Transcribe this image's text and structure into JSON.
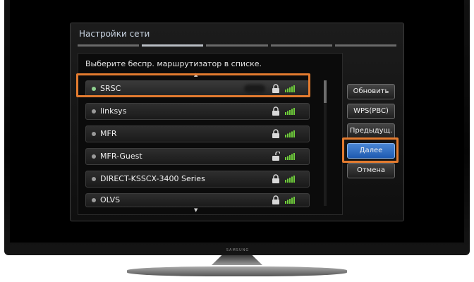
{
  "tv": {
    "brand": "SAMSUNG"
  },
  "dialog": {
    "title": "Настройки сети",
    "progress_step": 2,
    "progress_total": 5
  },
  "list": {
    "heading": "Выберите беспр. маршрутизатор в списке.",
    "selected_ssid": "SRSC",
    "networks": [
      {
        "ssid": "SRSC",
        "secured": true,
        "signal_bars": 4
      },
      {
        "ssid": "linksys",
        "secured": true,
        "signal_bars": 4
      },
      {
        "ssid": "MFR",
        "secured": true,
        "signal_bars": 4
      },
      {
        "ssid": "MFR-Guest",
        "secured": false,
        "signal_bars": 4
      },
      {
        "ssid": "DIRECT-KSSCX-3400 Series",
        "secured": true,
        "signal_bars": 4
      },
      {
        "ssid": "OLVS",
        "secured": true,
        "signal_bars": 4
      }
    ]
  },
  "buttons": {
    "refresh": "Обновить",
    "wps": "WPS(PBC)",
    "previous": "Предыдущ.",
    "next": "Далее",
    "cancel": "Отмена"
  },
  "colors": {
    "highlight": "#e37b2f",
    "signal": "#6fcf3a",
    "active_button": "#2f6fc8"
  }
}
